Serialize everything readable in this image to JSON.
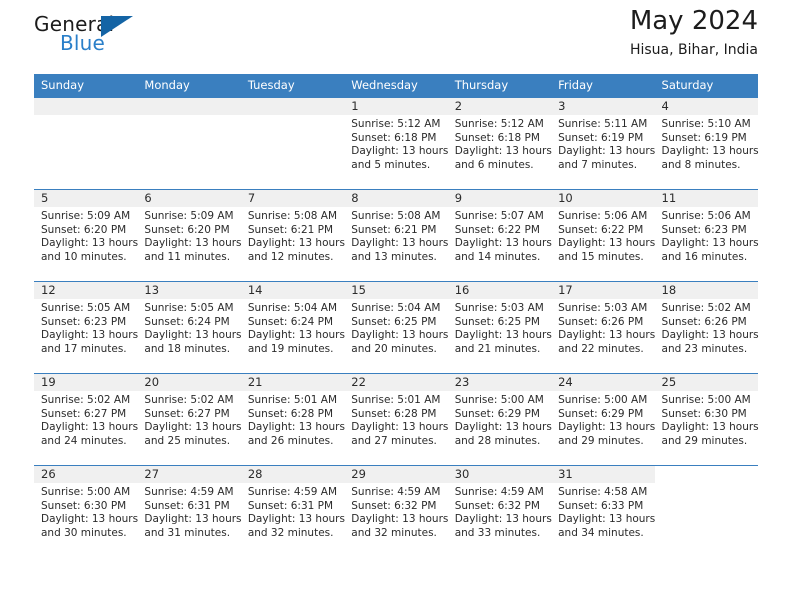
{
  "brand": {
    "word_general": "General",
    "word_blue": "Blue",
    "accent_color": "#1464a5",
    "blue_text_color": "#2a7fc9"
  },
  "header": {
    "title": "May 2024",
    "location": "Hisua, Bihar, India",
    "header_bg": "#3a7fbf",
    "daynum_bg": "#f0f0f0"
  },
  "weekday_headers": [
    "Sunday",
    "Monday",
    "Tuesday",
    "Wednesday",
    "Thursday",
    "Friday",
    "Saturday"
  ],
  "labels": {
    "sunrise": "Sunrise:",
    "sunset": "Sunset:",
    "daylight": "Daylight:"
  },
  "weeks": [
    [
      {
        "day": "",
        "empty": true
      },
      {
        "day": "",
        "empty": true
      },
      {
        "day": "",
        "empty": true
      },
      {
        "day": "1",
        "sunrise": "Sunrise: 5:12 AM",
        "sunset": "Sunset: 6:18 PM",
        "daylight1": "Daylight: 13 hours",
        "daylight2": "and 5 minutes."
      },
      {
        "day": "2",
        "sunrise": "Sunrise: 5:12 AM",
        "sunset": "Sunset: 6:18 PM",
        "daylight1": "Daylight: 13 hours",
        "daylight2": "and 6 minutes."
      },
      {
        "day": "3",
        "sunrise": "Sunrise: 5:11 AM",
        "sunset": "Sunset: 6:19 PM",
        "daylight1": "Daylight: 13 hours",
        "daylight2": "and 7 minutes."
      },
      {
        "day": "4",
        "sunrise": "Sunrise: 5:10 AM",
        "sunset": "Sunset: 6:19 PM",
        "daylight1": "Daylight: 13 hours",
        "daylight2": "and 8 minutes."
      }
    ],
    [
      {
        "day": "5",
        "sunrise": "Sunrise: 5:09 AM",
        "sunset": "Sunset: 6:20 PM",
        "daylight1": "Daylight: 13 hours",
        "daylight2": "and 10 minutes."
      },
      {
        "day": "6",
        "sunrise": "Sunrise: 5:09 AM",
        "sunset": "Sunset: 6:20 PM",
        "daylight1": "Daylight: 13 hours",
        "daylight2": "and 11 minutes."
      },
      {
        "day": "7",
        "sunrise": "Sunrise: 5:08 AM",
        "sunset": "Sunset: 6:21 PM",
        "daylight1": "Daylight: 13 hours",
        "daylight2": "and 12 minutes."
      },
      {
        "day": "8",
        "sunrise": "Sunrise: 5:08 AM",
        "sunset": "Sunset: 6:21 PM",
        "daylight1": "Daylight: 13 hours",
        "daylight2": "and 13 minutes."
      },
      {
        "day": "9",
        "sunrise": "Sunrise: 5:07 AM",
        "sunset": "Sunset: 6:22 PM",
        "daylight1": "Daylight: 13 hours",
        "daylight2": "and 14 minutes."
      },
      {
        "day": "10",
        "sunrise": "Sunrise: 5:06 AM",
        "sunset": "Sunset: 6:22 PM",
        "daylight1": "Daylight: 13 hours",
        "daylight2": "and 15 minutes."
      },
      {
        "day": "11",
        "sunrise": "Sunrise: 5:06 AM",
        "sunset": "Sunset: 6:23 PM",
        "daylight1": "Daylight: 13 hours",
        "daylight2": "and 16 minutes."
      }
    ],
    [
      {
        "day": "12",
        "sunrise": "Sunrise: 5:05 AM",
        "sunset": "Sunset: 6:23 PM",
        "daylight1": "Daylight: 13 hours",
        "daylight2": "and 17 minutes."
      },
      {
        "day": "13",
        "sunrise": "Sunrise: 5:05 AM",
        "sunset": "Sunset: 6:24 PM",
        "daylight1": "Daylight: 13 hours",
        "daylight2": "and 18 minutes."
      },
      {
        "day": "14",
        "sunrise": "Sunrise: 5:04 AM",
        "sunset": "Sunset: 6:24 PM",
        "daylight1": "Daylight: 13 hours",
        "daylight2": "and 19 minutes."
      },
      {
        "day": "15",
        "sunrise": "Sunrise: 5:04 AM",
        "sunset": "Sunset: 6:25 PM",
        "daylight1": "Daylight: 13 hours",
        "daylight2": "and 20 minutes."
      },
      {
        "day": "16",
        "sunrise": "Sunrise: 5:03 AM",
        "sunset": "Sunset: 6:25 PM",
        "daylight1": "Daylight: 13 hours",
        "daylight2": "and 21 minutes."
      },
      {
        "day": "17",
        "sunrise": "Sunrise: 5:03 AM",
        "sunset": "Sunset: 6:26 PM",
        "daylight1": "Daylight: 13 hours",
        "daylight2": "and 22 minutes."
      },
      {
        "day": "18",
        "sunrise": "Sunrise: 5:02 AM",
        "sunset": "Sunset: 6:26 PM",
        "daylight1": "Daylight: 13 hours",
        "daylight2": "and 23 minutes."
      }
    ],
    [
      {
        "day": "19",
        "sunrise": "Sunrise: 5:02 AM",
        "sunset": "Sunset: 6:27 PM",
        "daylight1": "Daylight: 13 hours",
        "daylight2": "and 24 minutes."
      },
      {
        "day": "20",
        "sunrise": "Sunrise: 5:02 AM",
        "sunset": "Sunset: 6:27 PM",
        "daylight1": "Daylight: 13 hours",
        "daylight2": "and 25 minutes."
      },
      {
        "day": "21",
        "sunrise": "Sunrise: 5:01 AM",
        "sunset": "Sunset: 6:28 PM",
        "daylight1": "Daylight: 13 hours",
        "daylight2": "and 26 minutes."
      },
      {
        "day": "22",
        "sunrise": "Sunrise: 5:01 AM",
        "sunset": "Sunset: 6:28 PM",
        "daylight1": "Daylight: 13 hours",
        "daylight2": "and 27 minutes."
      },
      {
        "day": "23",
        "sunrise": "Sunrise: 5:00 AM",
        "sunset": "Sunset: 6:29 PM",
        "daylight1": "Daylight: 13 hours",
        "daylight2": "and 28 minutes."
      },
      {
        "day": "24",
        "sunrise": "Sunrise: 5:00 AM",
        "sunset": "Sunset: 6:29 PM",
        "daylight1": "Daylight: 13 hours",
        "daylight2": "and 29 minutes."
      },
      {
        "day": "25",
        "sunrise": "Sunrise: 5:00 AM",
        "sunset": "Sunset: 6:30 PM",
        "daylight1": "Daylight: 13 hours",
        "daylight2": "and 29 minutes."
      }
    ],
    [
      {
        "day": "26",
        "sunrise": "Sunrise: 5:00 AM",
        "sunset": "Sunset: 6:30 PM",
        "daylight1": "Daylight: 13 hours",
        "daylight2": "and 30 minutes."
      },
      {
        "day": "27",
        "sunrise": "Sunrise: 4:59 AM",
        "sunset": "Sunset: 6:31 PM",
        "daylight1": "Daylight: 13 hours",
        "daylight2": "and 31 minutes."
      },
      {
        "day": "28",
        "sunrise": "Sunrise: 4:59 AM",
        "sunset": "Sunset: 6:31 PM",
        "daylight1": "Daylight: 13 hours",
        "daylight2": "and 32 minutes."
      },
      {
        "day": "29",
        "sunrise": "Sunrise: 4:59 AM",
        "sunset": "Sunset: 6:32 PM",
        "daylight1": "Daylight: 13 hours",
        "daylight2": "and 32 minutes."
      },
      {
        "day": "30",
        "sunrise": "Sunrise: 4:59 AM",
        "sunset": "Sunset: 6:32 PM",
        "daylight1": "Daylight: 13 hours",
        "daylight2": "and 33 minutes."
      },
      {
        "day": "31",
        "sunrise": "Sunrise: 4:58 AM",
        "sunset": "Sunset: 6:33 PM",
        "daylight1": "Daylight: 13 hours",
        "daylight2": "and 34 minutes."
      },
      {
        "day": "",
        "empty": true,
        "blank": true
      }
    ]
  ]
}
